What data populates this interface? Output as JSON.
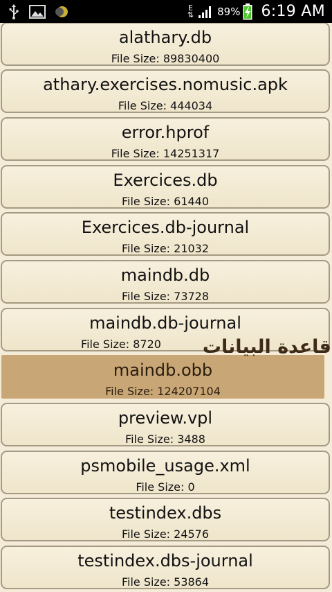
{
  "status_bar": {
    "network_type": "E",
    "battery_percent": "89%",
    "time": "6:19 AM",
    "icons": [
      "usb-icon",
      "gallery-icon",
      "moon-icon",
      "data-arrows-icon",
      "signal-icon",
      "battery-charging-icon"
    ]
  },
  "files": [
    {
      "name": "alathary.db",
      "size": "File Size: 89830400"
    },
    {
      "name": "athary.exercises.nomusic.apk",
      "size": "File Size: 444034"
    },
    {
      "name": "error.hprof",
      "size": "File Size: 14251317"
    },
    {
      "name": "Exercices.db",
      "size": "File Size: 61440"
    },
    {
      "name": "Exercices.db-journal",
      "size": "File Size: 21032"
    },
    {
      "name": "maindb.db",
      "size": "File Size: 73728"
    },
    {
      "name": "maindb.db-journal",
      "size": "File Size: 8720"
    },
    {
      "name": "maindb.obb",
      "size": "File Size: 124207104",
      "selected": true
    },
    {
      "name": "preview.vpl",
      "size": "File Size: 3488"
    },
    {
      "name": "psmobile_usage.xml",
      "size": "File Size: 0"
    },
    {
      "name": "testindex.dbs",
      "size": "File Size: 24576"
    },
    {
      "name": "testindex.dbs-journal",
      "size": "File Size: 53864"
    }
  ],
  "watermark": "قاعدة البيانات",
  "colors": {
    "item_background": "#f4ecd8",
    "item_border": "#a59a83",
    "selected_background": "#c8a676",
    "status_bar": "#000000"
  }
}
